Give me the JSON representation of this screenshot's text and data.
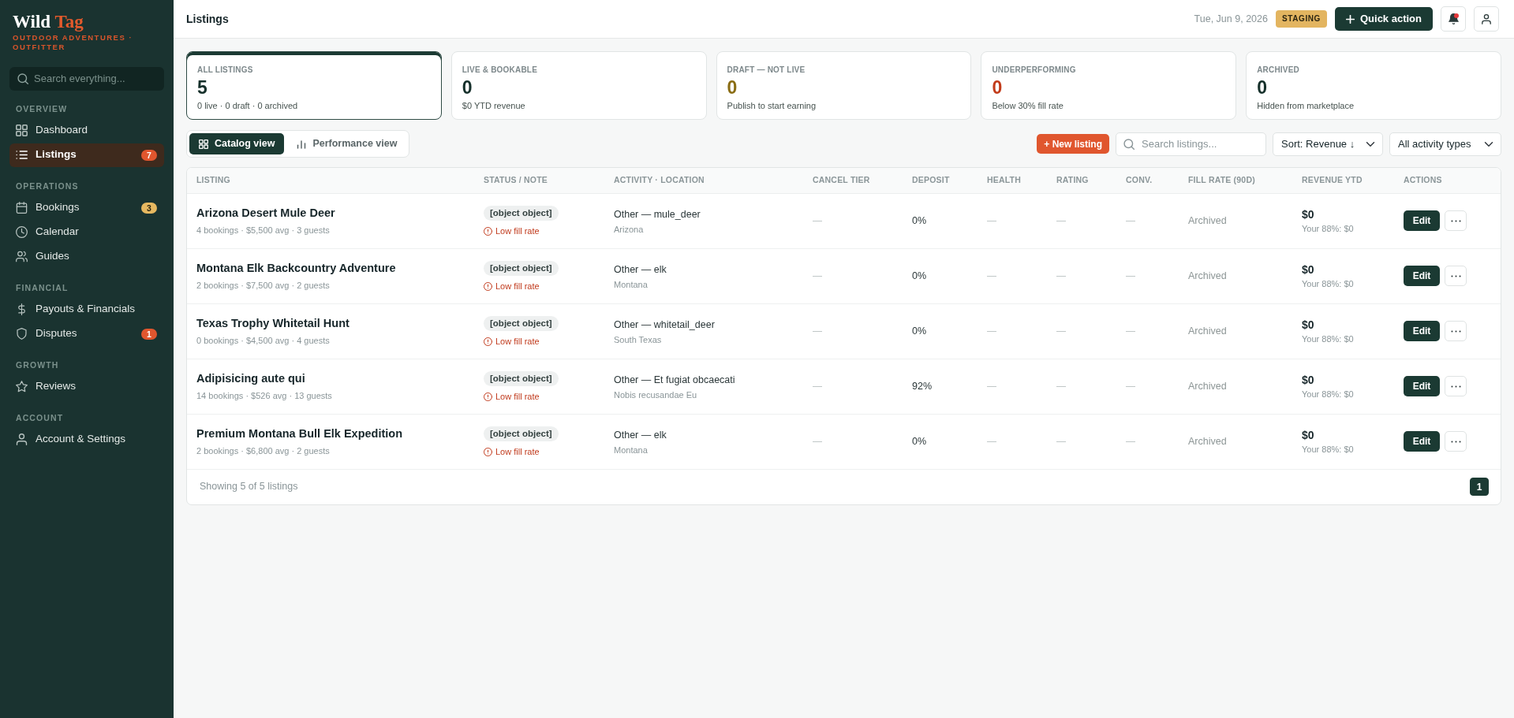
{
  "sidebar": {
    "logo": {
      "first": "Wild",
      "second": "Tag"
    },
    "tagline": "OUTDOOR ADVENTURES · OUTFITTER",
    "search": {
      "placeholder": "Search everything..."
    },
    "sections": [
      {
        "title": "OVERVIEW",
        "items": [
          {
            "label": "Dashboard",
            "selected": false
          },
          {
            "label": "Listings",
            "selected": true,
            "badge": {
              "text": "7",
              "color": "#e0562e"
            }
          }
        ]
      },
      {
        "title": "OPERATIONS",
        "items": [
          {
            "label": "Bookings",
            "selected": false,
            "badge": {
              "text": "3",
              "color": "#e6b860"
            }
          },
          {
            "label": "Calendar",
            "selected": false
          },
          {
            "label": "Guides",
            "selected": false
          }
        ]
      },
      {
        "title": "FINANCIAL",
        "items": [
          {
            "label": "Payouts & Financials",
            "selected": false
          },
          {
            "label": "Disputes",
            "selected": false,
            "badge": {
              "text": "1",
              "color": "#e0562e"
            }
          }
        ]
      },
      {
        "title": "GROWTH",
        "items": [
          {
            "label": "Reviews",
            "selected": false
          }
        ]
      },
      {
        "title": "ACCOUNT",
        "items": [
          {
            "label": "Account & Settings",
            "selected": false
          }
        ]
      }
    ]
  },
  "header": {
    "title": "Listings",
    "date": "Tue, Jun 9, 2026",
    "environment": "STAGING",
    "quick_action": "Quick action",
    "notifications": {
      "unread": true
    }
  },
  "stats": [
    {
      "label": "ALL LISTINGS",
      "value": "5",
      "note": "0 live · 0 draft · 0 archived",
      "selected": true,
      "color": "#16302b"
    },
    {
      "label": "LIVE & BOOKABLE",
      "value": "0",
      "note": "$0 YTD revenue",
      "selected": false,
      "color": "#16302b"
    },
    {
      "label": "DRAFT — NOT LIVE",
      "value": "0",
      "note": "Publish to start earning",
      "selected": false,
      "color": "#8a6d14"
    },
    {
      "label": "UNDERPERFORMING",
      "value": "0",
      "note": "Below 30% fill rate",
      "selected": false,
      "color": "#c23b1a"
    },
    {
      "label": "ARCHIVED",
      "value": "0",
      "note": "Hidden from marketplace",
      "selected": false,
      "color": "#16302b"
    }
  ],
  "view_toggle": [
    {
      "label": "Catalog view",
      "selected": true
    },
    {
      "label": "Performance view",
      "selected": false
    }
  ],
  "toolbar": {
    "new_listing": "+ New listing",
    "search": {
      "placeholder": "Search listings..."
    },
    "sort": {
      "value": "Sort: Revenue ↓"
    },
    "filter": {
      "value": "All activity types"
    }
  },
  "table": {
    "columns": [
      "LISTING",
      "STATUS / NOTE",
      "ACTIVITY · LOCATION",
      "CANCEL TIER",
      "DEPOSIT",
      "HEALTH",
      "RATING",
      "CONV.",
      "FILL RATE (90D)",
      "REVENUE YTD",
      "ACTIONS"
    ],
    "rows": [
      {
        "listing": "Arizona Desert Mule Deer",
        "meta": "4 bookings · $5,500 avg · 3 guests",
        "status": "[object object]",
        "note": "Low fill rate",
        "activity": "Other — mule_deer",
        "location": "Arizona",
        "cancel_tier": "—",
        "deposit": "0%",
        "health": "—",
        "rating": "—",
        "conversion": "—",
        "fill_rate": "Archived",
        "revenue": "$0",
        "revenue_share": "Your 88%: $0",
        "edit": "Edit"
      },
      {
        "listing": "Montana Elk Backcountry Adventure",
        "meta": "2 bookings · $7,500 avg · 2 guests",
        "status": "[object object]",
        "note": "Low fill rate",
        "activity": "Other — elk",
        "location": "Montana",
        "cancel_tier": "—",
        "deposit": "0%",
        "health": "—",
        "rating": "—",
        "conversion": "—",
        "fill_rate": "Archived",
        "revenue": "$0",
        "revenue_share": "Your 88%: $0",
        "edit": "Edit"
      },
      {
        "listing": "Texas Trophy Whitetail Hunt",
        "meta": "0 bookings · $4,500 avg · 4 guests",
        "status": "[object object]",
        "note": "Low fill rate",
        "activity": "Other — whitetail_deer",
        "location": "South Texas",
        "cancel_tier": "—",
        "deposit": "0%",
        "health": "—",
        "rating": "—",
        "conversion": "—",
        "fill_rate": "Archived",
        "revenue": "$0",
        "revenue_share": "Your 88%: $0",
        "edit": "Edit"
      },
      {
        "listing": "Adipisicing aute qui",
        "meta": "14 bookings · $526 avg · 13 guests",
        "status": "[object object]",
        "note": "Low fill rate",
        "activity": "Other — Et fugiat obcaecati",
        "location": "Nobis recusandae Eu",
        "cancel_tier": "—",
        "deposit": "92%",
        "health": "—",
        "rating": "—",
        "conversion": "—",
        "fill_rate": "Archived",
        "revenue": "$0",
        "revenue_share": "Your 88%: $0",
        "edit": "Edit"
      },
      {
        "listing": "Premium Montana Bull Elk Expedition",
        "meta": "2 bookings · $6,800 avg · 2 guests",
        "status": "[object object]",
        "note": "Low fill rate",
        "activity": "Other — elk",
        "location": "Montana",
        "cancel_tier": "—",
        "deposit": "0%",
        "health": "—",
        "rating": "—",
        "conversion": "—",
        "fill_rate": "Archived",
        "revenue": "$0",
        "revenue_share": "Your 88%: $0",
        "edit": "Edit"
      }
    ]
  },
  "footer": {
    "summary": "Showing 5 of 5 listings",
    "pages": [
      {
        "label": "1",
        "selected": true
      }
    ]
  }
}
